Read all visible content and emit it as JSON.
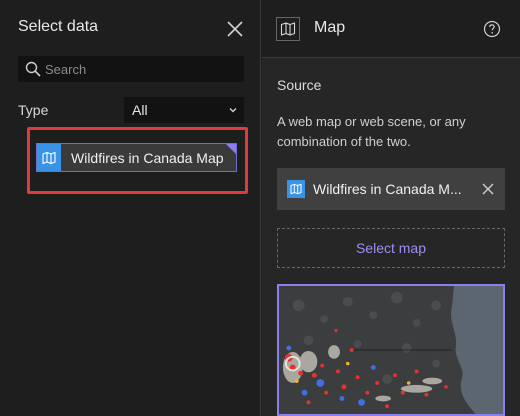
{
  "select_data": {
    "title": "Select data",
    "search": {
      "placeholder": "Search",
      "value": ""
    },
    "type_label": "Type",
    "type_filter": {
      "selected": "All"
    },
    "items": [
      {
        "name": "Wildfires in Canada Map",
        "icon": "map-icon"
      }
    ]
  },
  "map_panel": {
    "title": "Map",
    "source_label": "Source",
    "source_description": "A web map or web scene, or any combination of the two.",
    "selected_map": "Wildfires in Canada M...",
    "select_button": "Select map"
  },
  "colors": {
    "accent": "#8b7ff0",
    "item_badge": "#3a94e6",
    "highlight": "#e0393e",
    "link": "#9d8ff5"
  }
}
